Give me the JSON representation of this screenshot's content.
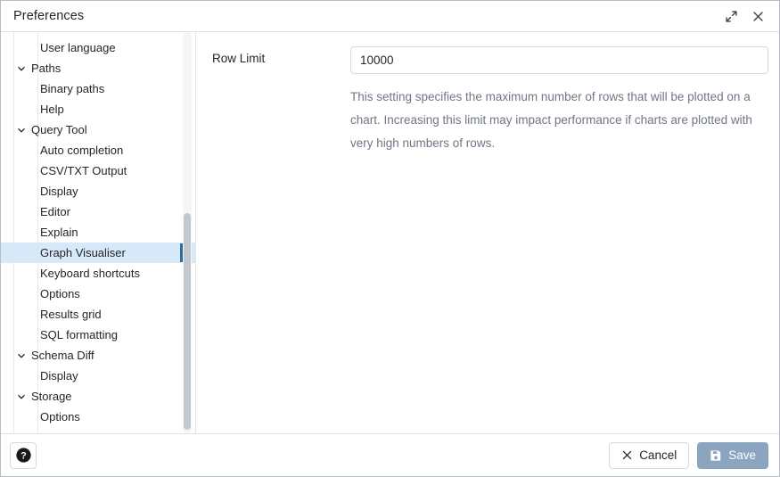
{
  "window": {
    "title": "Preferences",
    "expand_icon": "expand-diagonal-icon",
    "close_icon": "close-icon"
  },
  "sidebar": {
    "scrollbar": {
      "thumb_top_pct": 45,
      "thumb_height_pct": 54
    },
    "items": [
      {
        "label": "User language",
        "level": "child",
        "expanded": null,
        "selected": false
      },
      {
        "label": "Paths",
        "level": "group",
        "expanded": true,
        "selected": false
      },
      {
        "label": "Binary paths",
        "level": "child",
        "expanded": null,
        "selected": false
      },
      {
        "label": "Help",
        "level": "child",
        "expanded": null,
        "selected": false
      },
      {
        "label": "Query Tool",
        "level": "group",
        "expanded": true,
        "selected": false
      },
      {
        "label": "Auto completion",
        "level": "child",
        "expanded": null,
        "selected": false
      },
      {
        "label": "CSV/TXT Output",
        "level": "child",
        "expanded": null,
        "selected": false
      },
      {
        "label": "Display",
        "level": "child",
        "expanded": null,
        "selected": false
      },
      {
        "label": "Editor",
        "level": "child",
        "expanded": null,
        "selected": false
      },
      {
        "label": "Explain",
        "level": "child",
        "expanded": null,
        "selected": false
      },
      {
        "label": "Graph Visualiser",
        "level": "child",
        "expanded": null,
        "selected": true
      },
      {
        "label": "Keyboard shortcuts",
        "level": "child",
        "expanded": null,
        "selected": false
      },
      {
        "label": "Options",
        "level": "child",
        "expanded": null,
        "selected": false
      },
      {
        "label": "Results grid",
        "level": "child",
        "expanded": null,
        "selected": false
      },
      {
        "label": "SQL formatting",
        "level": "child",
        "expanded": null,
        "selected": false
      },
      {
        "label": "Schema Diff",
        "level": "group",
        "expanded": true,
        "selected": false
      },
      {
        "label": "Display",
        "level": "child",
        "expanded": null,
        "selected": false
      },
      {
        "label": "Storage",
        "level": "group",
        "expanded": true,
        "selected": false
      },
      {
        "label": "Options",
        "level": "child",
        "expanded": null,
        "selected": false
      }
    ]
  },
  "content": {
    "row_limit": {
      "label": "Row Limit",
      "value": "10000",
      "placeholder": "",
      "help": "This setting specifies the maximum number of rows that will be plotted on a chart. Increasing this limit may impact performance if charts are plotted with very high numbers of rows."
    }
  },
  "footer": {
    "help_label": "?",
    "cancel_label": "Cancel",
    "save_label": "Save"
  },
  "colors": {
    "selection_bg": "#d7e8f8",
    "selection_bar": "#2c6ca8",
    "save_button_bg": "#8ba4c0",
    "help_text": "#6f7684",
    "border": "#dfe1e5"
  }
}
